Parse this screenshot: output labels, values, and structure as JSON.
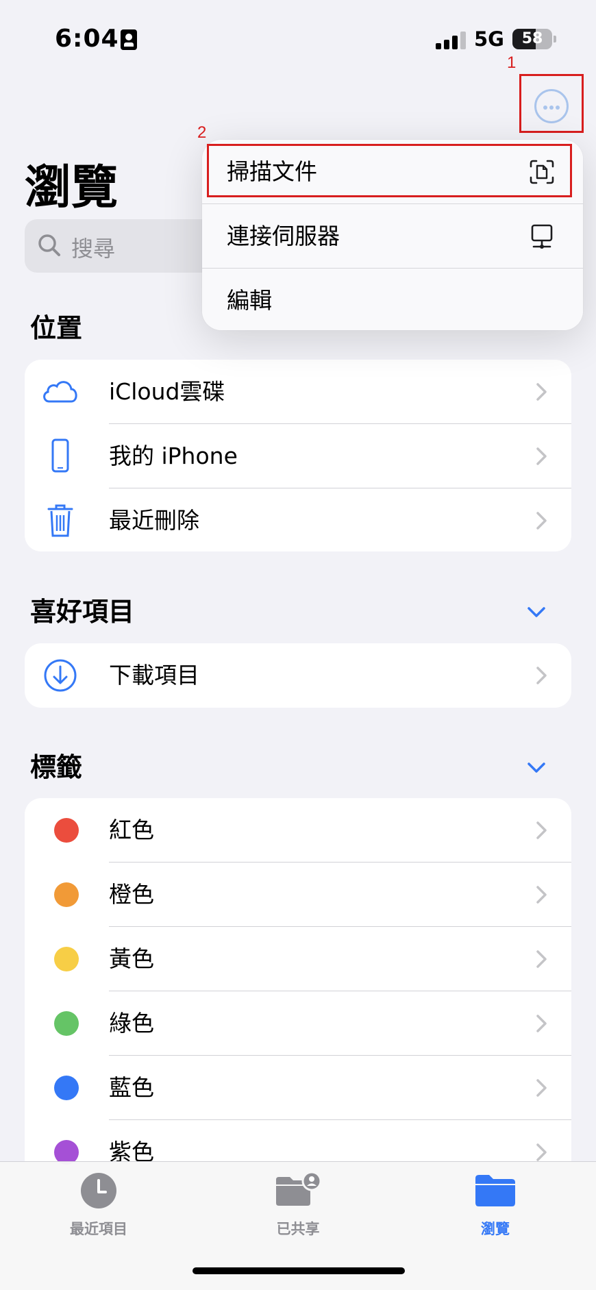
{
  "status_bar": {
    "time": "6:04",
    "network": "5G",
    "battery": "58"
  },
  "annotations": {
    "one": "1",
    "two": "2"
  },
  "header": {
    "title": "瀏覽",
    "more_icon": "ellipsis-circle-icon"
  },
  "search": {
    "placeholder": "搜尋",
    "icon": "search-icon"
  },
  "menu": {
    "items": [
      {
        "label": "掃描文件",
        "icon": "doc-viewfinder-icon"
      },
      {
        "label": "連接伺服器",
        "icon": "desktop-server-icon"
      },
      {
        "label": "編輯"
      }
    ]
  },
  "locations": {
    "title": "位置",
    "items": [
      {
        "label": "iCloud雲碟",
        "icon": "icloud-icon"
      },
      {
        "label": "我的 iPhone",
        "icon": "iphone-icon"
      },
      {
        "label": "最近刪除",
        "icon": "trash-icon"
      }
    ]
  },
  "favorites": {
    "title": "喜好項目",
    "items": [
      {
        "label": "下載項目",
        "icon": "download-circle-icon"
      }
    ]
  },
  "tags": {
    "title": "標籤",
    "items": [
      {
        "label": "紅色",
        "color": "#eb4d3d"
      },
      {
        "label": "橙色",
        "color": "#f19a37"
      },
      {
        "label": "黃色",
        "color": "#f7ce46"
      },
      {
        "label": "綠色",
        "color": "#65c466"
      },
      {
        "label": "藍色",
        "color": "#3478f6"
      },
      {
        "label": "紫色",
        "color": "#a550d6"
      }
    ]
  },
  "tabbar": {
    "items": [
      {
        "label": "最近項目",
        "icon": "clock-icon",
        "color": "#8e8e93"
      },
      {
        "label": "已共享",
        "icon": "shared-folder-icon",
        "color": "#8e8e93"
      },
      {
        "label": "瀏覽",
        "icon": "folder-icon",
        "color": "#3478f6"
      }
    ]
  }
}
